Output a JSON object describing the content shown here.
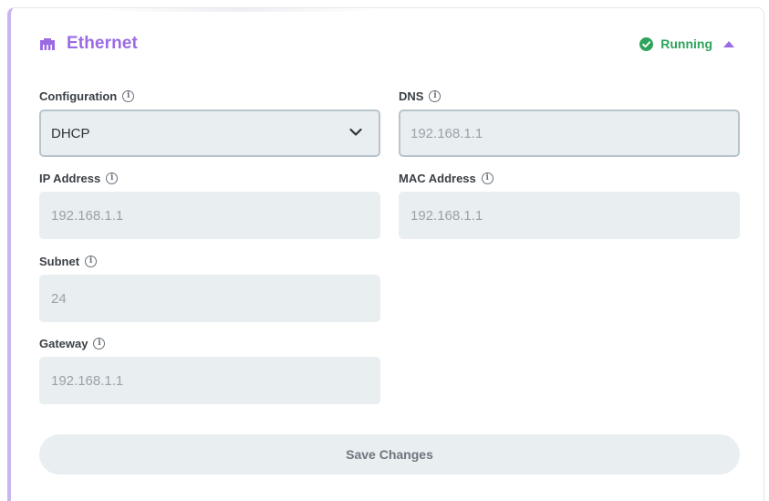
{
  "header": {
    "title": "Ethernet",
    "status": "Running",
    "icon": "ethernet-port-icon",
    "status_icon": "check-circle-icon",
    "toggle_icon": "caret-up-icon"
  },
  "fields": {
    "configuration": {
      "label": "Configuration",
      "value": "DHCP"
    },
    "dns": {
      "label": "DNS",
      "value": "192.168.1.1"
    },
    "ip_address": {
      "label": "IP Address",
      "value": "192.168.1.1"
    },
    "mac_address": {
      "label": "MAC Address",
      "value": "192.168.1.1"
    },
    "subnet": {
      "label": "Subnet",
      "value": "24"
    },
    "gateway": {
      "label": "Gateway",
      "value": "192.168.1.1"
    }
  },
  "info_glyph": "i",
  "save_label": "Save Changes",
  "colors": {
    "accent": "#9b6be4",
    "status_green": "#2ea35a",
    "input_bg": "#e9eef1",
    "label_text": "#3b4046"
  }
}
